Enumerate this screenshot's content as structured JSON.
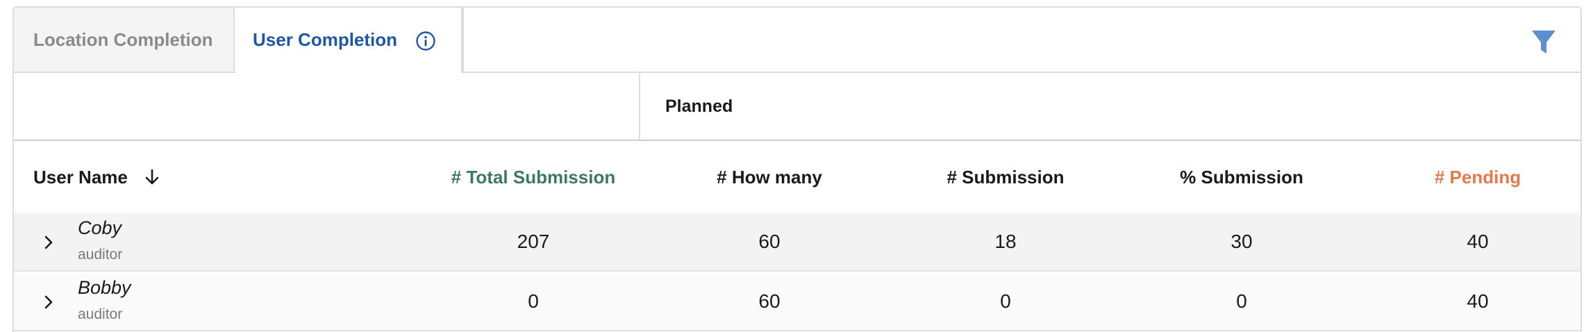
{
  "tabs": {
    "location_label": "Location Completion",
    "user_label": "User Completion"
  },
  "group": {
    "planned_label": "Planned"
  },
  "columns": {
    "user_name": "User Name",
    "total_submission": "# Total Submission",
    "how_many": "# How many",
    "submission": "# Submission",
    "pct_submission": "% Submission",
    "pending": "# Pending"
  },
  "rows": [
    {
      "name": "Coby",
      "role": "auditor",
      "total_submission": "207",
      "how_many": "60",
      "submission": "18",
      "pct_submission": "30",
      "pending": "40"
    },
    {
      "name": "Bobby",
      "role": "auditor",
      "total_submission": "0",
      "how_many": "60",
      "submission": "0",
      "pct_submission": "0",
      "pending": "40"
    }
  ],
  "icons": {
    "info": "info-circle-icon",
    "filter": "filter-funnel-icon",
    "sort": "arrow-down-icon",
    "expand": "chevron-right-icon"
  },
  "colors": {
    "active_tab": "#1f56a8",
    "total_submission_header": "#3c7a5e",
    "pending_header": "#e8784a",
    "filter_icon": "#5b8fd0"
  }
}
